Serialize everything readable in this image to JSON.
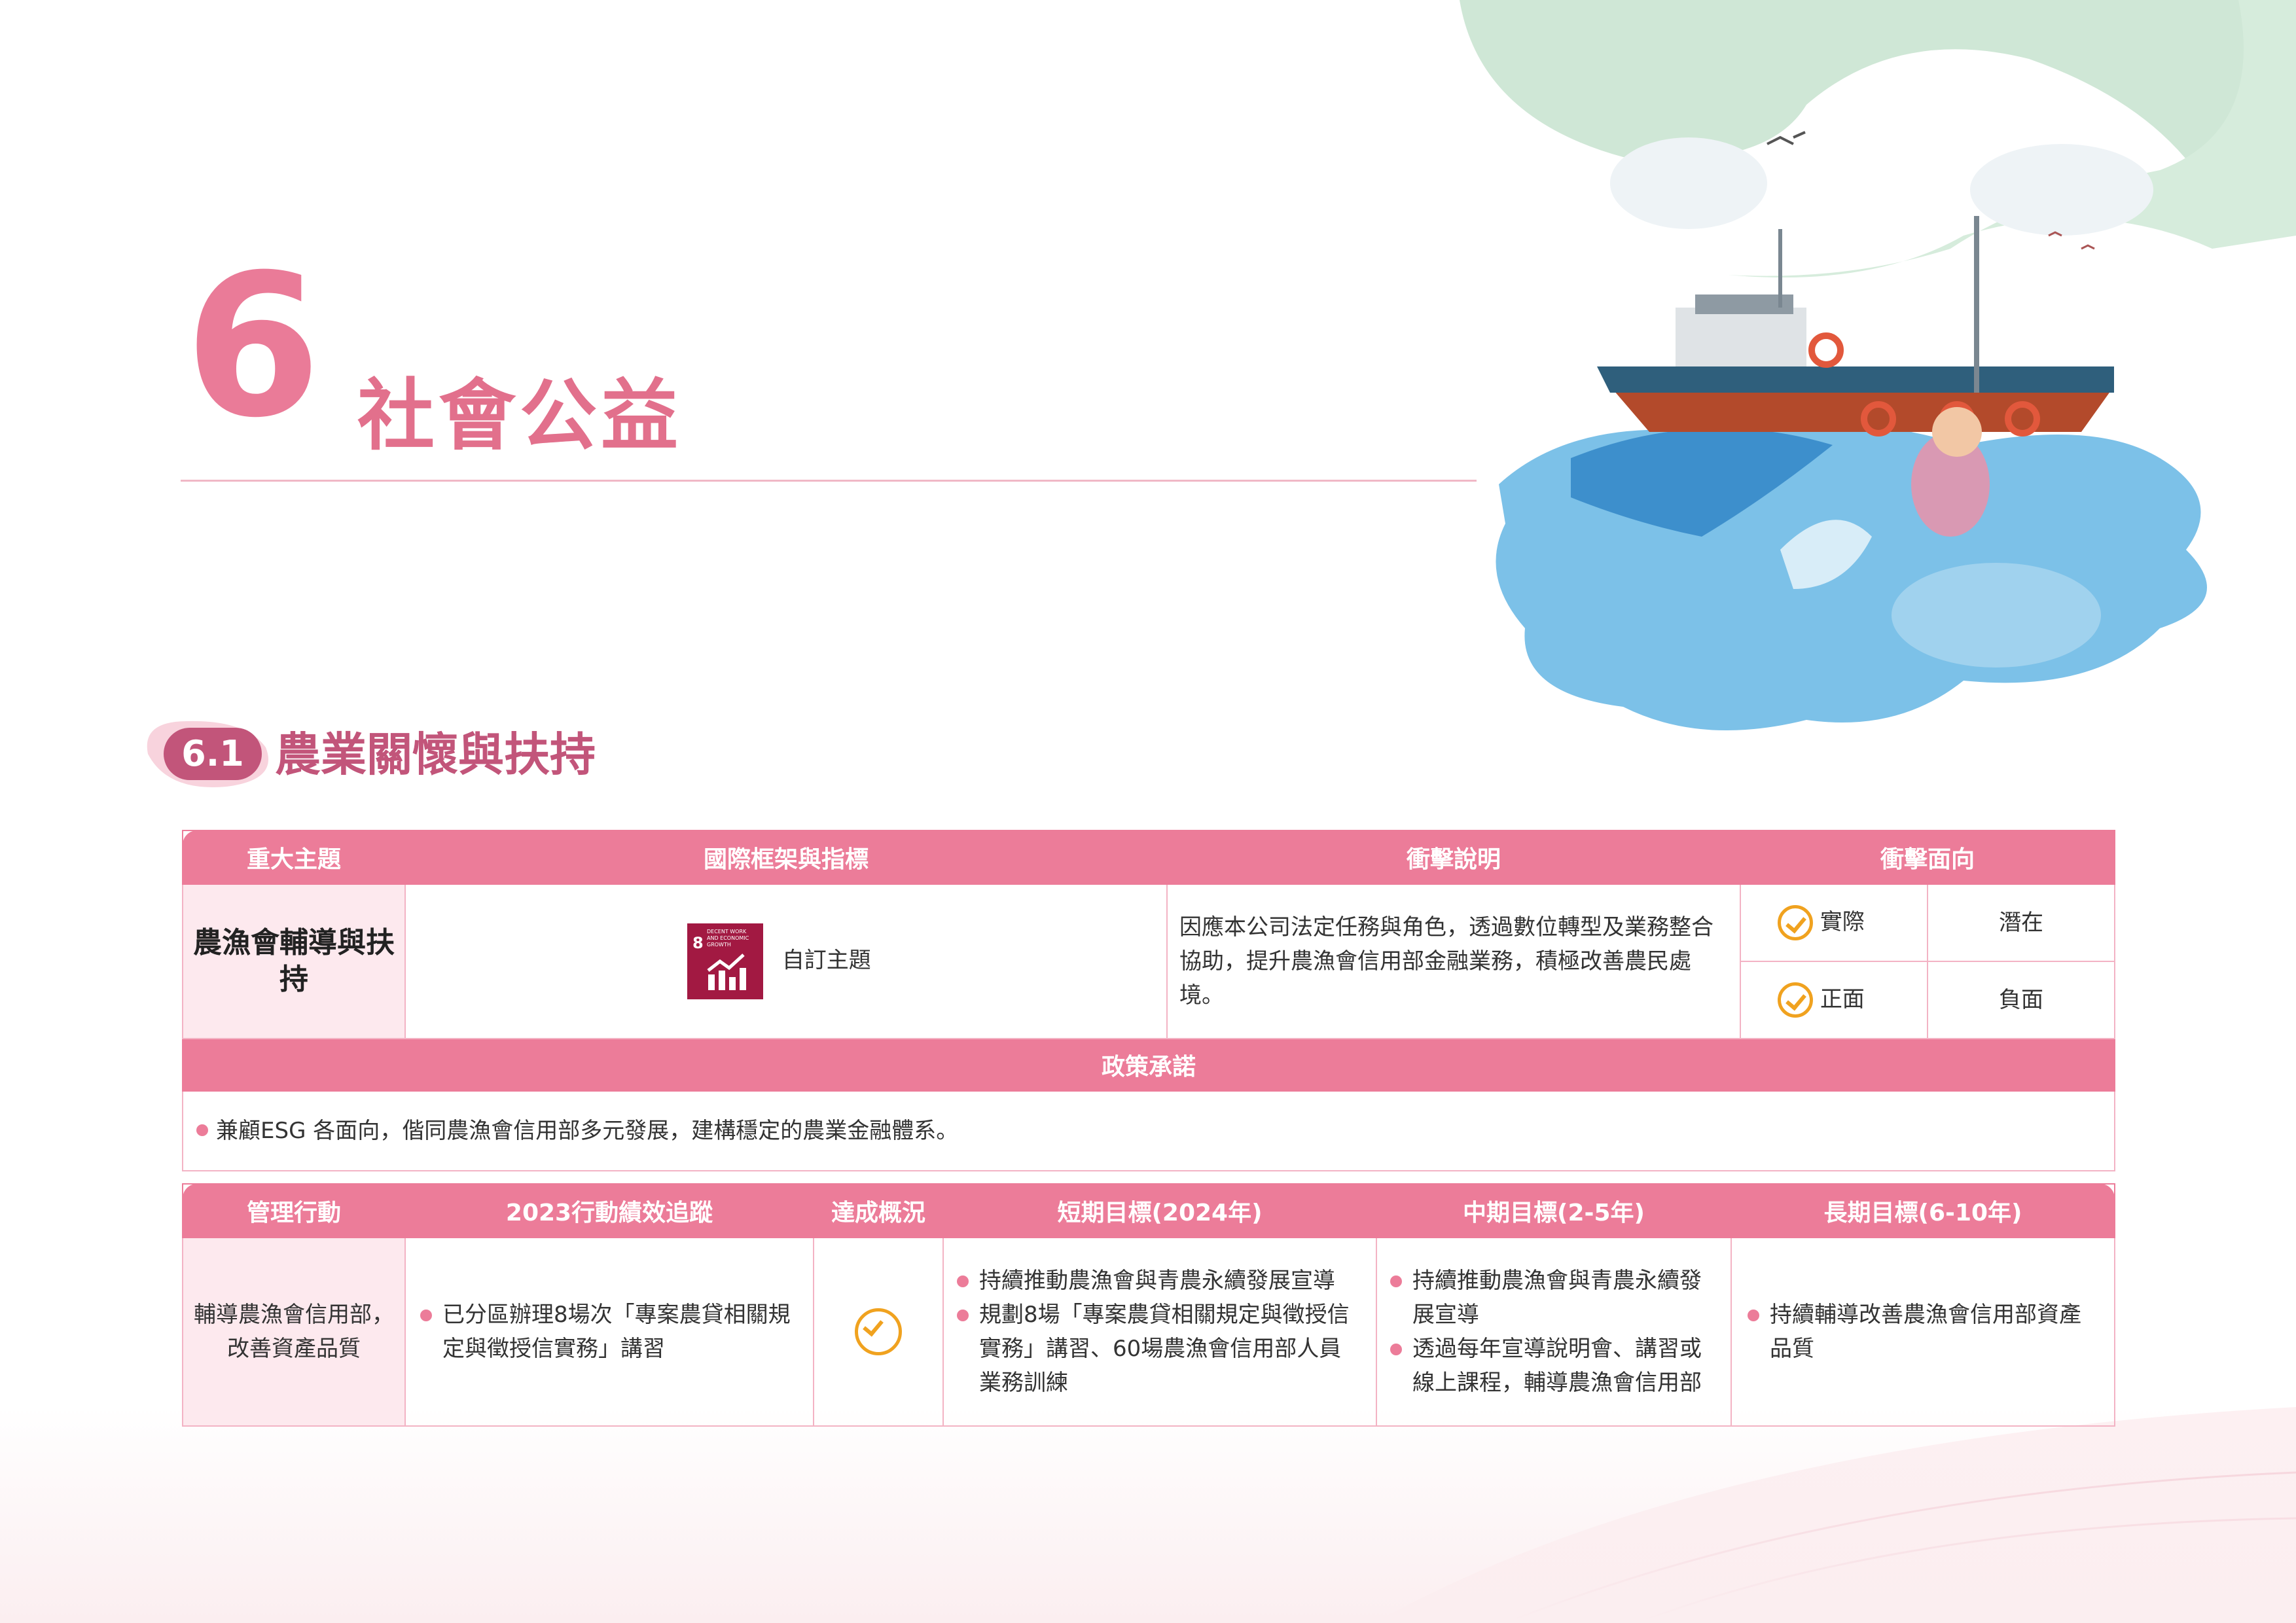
{
  "chapter": {
    "number": "6",
    "title": "社會公益"
  },
  "section": {
    "number": "6.1",
    "title": "農業關懷與扶持"
  },
  "table1": {
    "headers": [
      "重大主題",
      "國際框架與指標",
      "衝擊說明",
      "衝擊面向"
    ],
    "topic": "農漁會輔導與扶持",
    "sdg_number": "8",
    "sdg_label": "DECENT WORK AND ECONOMIC GROWTH",
    "framework": "自訂主題",
    "impact_desc": "因應本公司法定任務與角色，透過數位轉型及業務整合協助，提升農漁會信用部金融業務，積極改善農民處境。",
    "aspects": {
      "actual": "實際",
      "potential": "潛在",
      "positive": "正面",
      "negative": "負面"
    },
    "policy_header": "政策承諾",
    "policy": "兼顧ESG 各面向，偕同農漁會信用部多元發展，建構穩定的農業金融體系。"
  },
  "table2": {
    "headers": [
      "管理行動",
      "2023行動績效追蹤",
      "達成概況",
      "短期目標(2024年)",
      "中期目標(2-5年)",
      "長期目標(6-10年)"
    ],
    "action": "輔導農漁會信用部，改善資產品質",
    "performance": [
      "已分區辦理8場次「專案農貸相關規定與徵授信實務」講習"
    ],
    "short_term": [
      "持續推動農漁會與青農永續發展宣導",
      "規劃8場「專案農貸相關規定與徵授信實務」講習、60場農漁會信用部人員業務訓練"
    ],
    "mid_term": [
      "持續推動農漁會與青農永續發展宣導",
      "透過每年宣導說明會、講習或線上課程，輔導農漁會信用部"
    ],
    "long_term": [
      "持續輔導改善農漁會信用部資產品質"
    ]
  },
  "colors": {
    "accent": "#ec7c99",
    "dark_accent": "#c2557a",
    "check": "#f0a21f",
    "sdg8": "#a21942"
  }
}
